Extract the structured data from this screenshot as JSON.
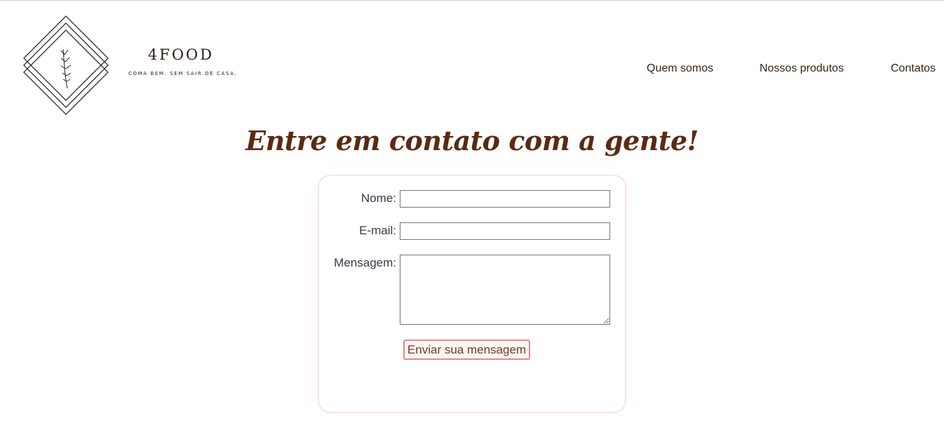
{
  "brand": {
    "name": "4FOOD",
    "tagline": "COMA BEM. SEM SAIR DE CASA."
  },
  "nav": {
    "items": [
      {
        "label": "Quem somos"
      },
      {
        "label": "Nossos produtos"
      },
      {
        "label": "Contatos"
      }
    ]
  },
  "contact": {
    "heading": "Entre em contato com a gente!",
    "name_label": "Nome:",
    "name_value": "",
    "email_label": "E-mail:",
    "email_value": "",
    "message_label": "Mensagem:",
    "message_value": "",
    "submit_label": "Enviar sua mensagem"
  },
  "colors": {
    "heading": "#5a2a12",
    "form_border": "#fde2e2",
    "button_border": "#d98a93",
    "text": "#3b2217"
  }
}
